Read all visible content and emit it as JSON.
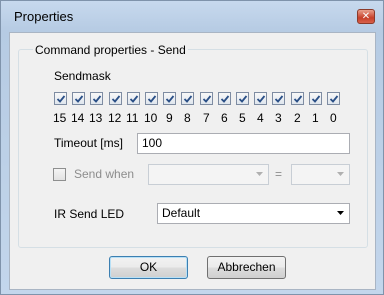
{
  "window": {
    "title": "Properties",
    "close_icon": "close-icon"
  },
  "group": {
    "title": "Command properties - Send"
  },
  "sendmask": {
    "label": "Sendmask",
    "bits": [
      {
        "label": "15",
        "checked": true
      },
      {
        "label": "14",
        "checked": true
      },
      {
        "label": "13",
        "checked": true
      },
      {
        "label": "12",
        "checked": true
      },
      {
        "label": "11",
        "checked": true
      },
      {
        "label": "10",
        "checked": true
      },
      {
        "label": "9",
        "checked": true
      },
      {
        "label": "8",
        "checked": true
      },
      {
        "label": "7",
        "checked": true
      },
      {
        "label": "6",
        "checked": true
      },
      {
        "label": "5",
        "checked": true
      },
      {
        "label": "4",
        "checked": true
      },
      {
        "label": "3",
        "checked": true
      },
      {
        "label": "2",
        "checked": true
      },
      {
        "label": "1",
        "checked": true
      },
      {
        "label": "0",
        "checked": true
      }
    ]
  },
  "timeout": {
    "label": "Timeout [ms]",
    "value": "100"
  },
  "send_when": {
    "label": "Send when",
    "checked": false,
    "operator": "=",
    "left_value": "",
    "right_value": ""
  },
  "ir_led": {
    "label": "IR Send LED",
    "selected": "Default"
  },
  "buttons": {
    "ok": "OK",
    "cancel": "Abbrechen"
  }
}
